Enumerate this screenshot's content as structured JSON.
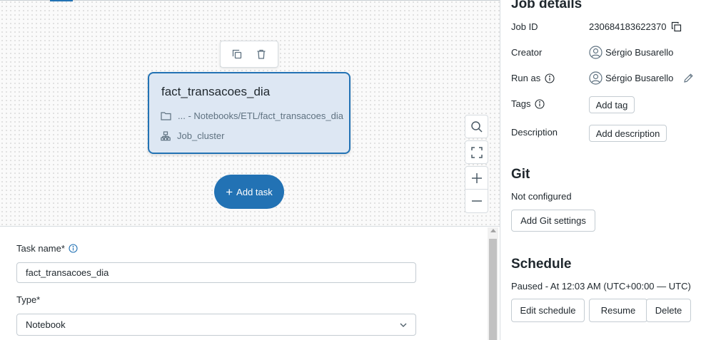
{
  "canvas": {
    "task_card": {
      "title": "fact_transacoes_dia",
      "path": "... - Notebooks/ETL/fact_transacoes_dia",
      "cluster": "Job_cluster"
    },
    "add_task_label": "Add task",
    "icons": {
      "toolbar": [
        "copy-icon",
        "trash-icon"
      ],
      "zoom": [
        "search-icon",
        "fit-view-icon",
        "zoom-in-icon",
        "zoom-out-icon"
      ]
    }
  },
  "task_form": {
    "task_name_label": "Task name*",
    "task_name_value": "fact_transacoes_dia",
    "type_label": "Type*",
    "type_value": "Notebook"
  },
  "job_details": {
    "heading": "Job details",
    "job_id_label": "Job ID",
    "job_id_value": "230684183622370",
    "creator_label": "Creator",
    "creator_value": "Sérgio Busarello",
    "run_as_label": "Run as",
    "run_as_value": "Sérgio Busarello",
    "tags_label": "Tags",
    "add_tag_label": "Add tag",
    "description_label": "Description",
    "add_description_label": "Add description"
  },
  "git": {
    "heading": "Git",
    "status": "Not configured",
    "add_git_settings_label": "Add Git settings"
  },
  "schedule": {
    "heading": "Schedule",
    "status": "Paused - At 12:03 AM (UTC+00:00 — UTC)",
    "edit_label": "Edit schedule",
    "resume_label": "Resume",
    "delete_label": "Delete"
  },
  "colors": {
    "accent": "#2272b4",
    "task_card_bg": "#dde7f3",
    "muted_text": "#5f7281",
    "border": "#c4ccd2"
  }
}
